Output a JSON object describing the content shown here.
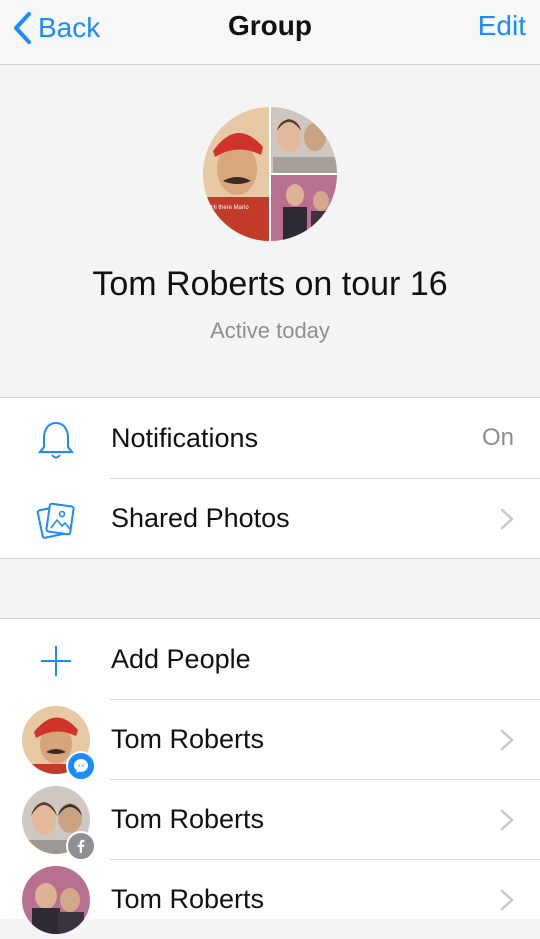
{
  "nav": {
    "back_label": "Back",
    "title": "Group",
    "edit_label": "Edit"
  },
  "group": {
    "name": "Tom Roberts on tour 16",
    "status": "Active today",
    "photo_caption": "Hi there Mario"
  },
  "settings": {
    "notifications": {
      "label": "Notifications",
      "value": "On",
      "icon": "bell-icon"
    },
    "shared_photos": {
      "label": "Shared Photos",
      "icon": "photos-icon"
    }
  },
  "members": {
    "add_label": "Add People",
    "people": [
      {
        "name": "Tom Roberts",
        "badge": "messenger"
      },
      {
        "name": "Tom Roberts",
        "badge": "facebook"
      },
      {
        "name": "Tom Roberts",
        "badge": "none"
      }
    ]
  },
  "colors": {
    "accent": "#1a8cff",
    "secondary_text": "#8e8e93",
    "messenger_badge": "#1a8cff",
    "facebook_badge": "#8e8e93"
  }
}
